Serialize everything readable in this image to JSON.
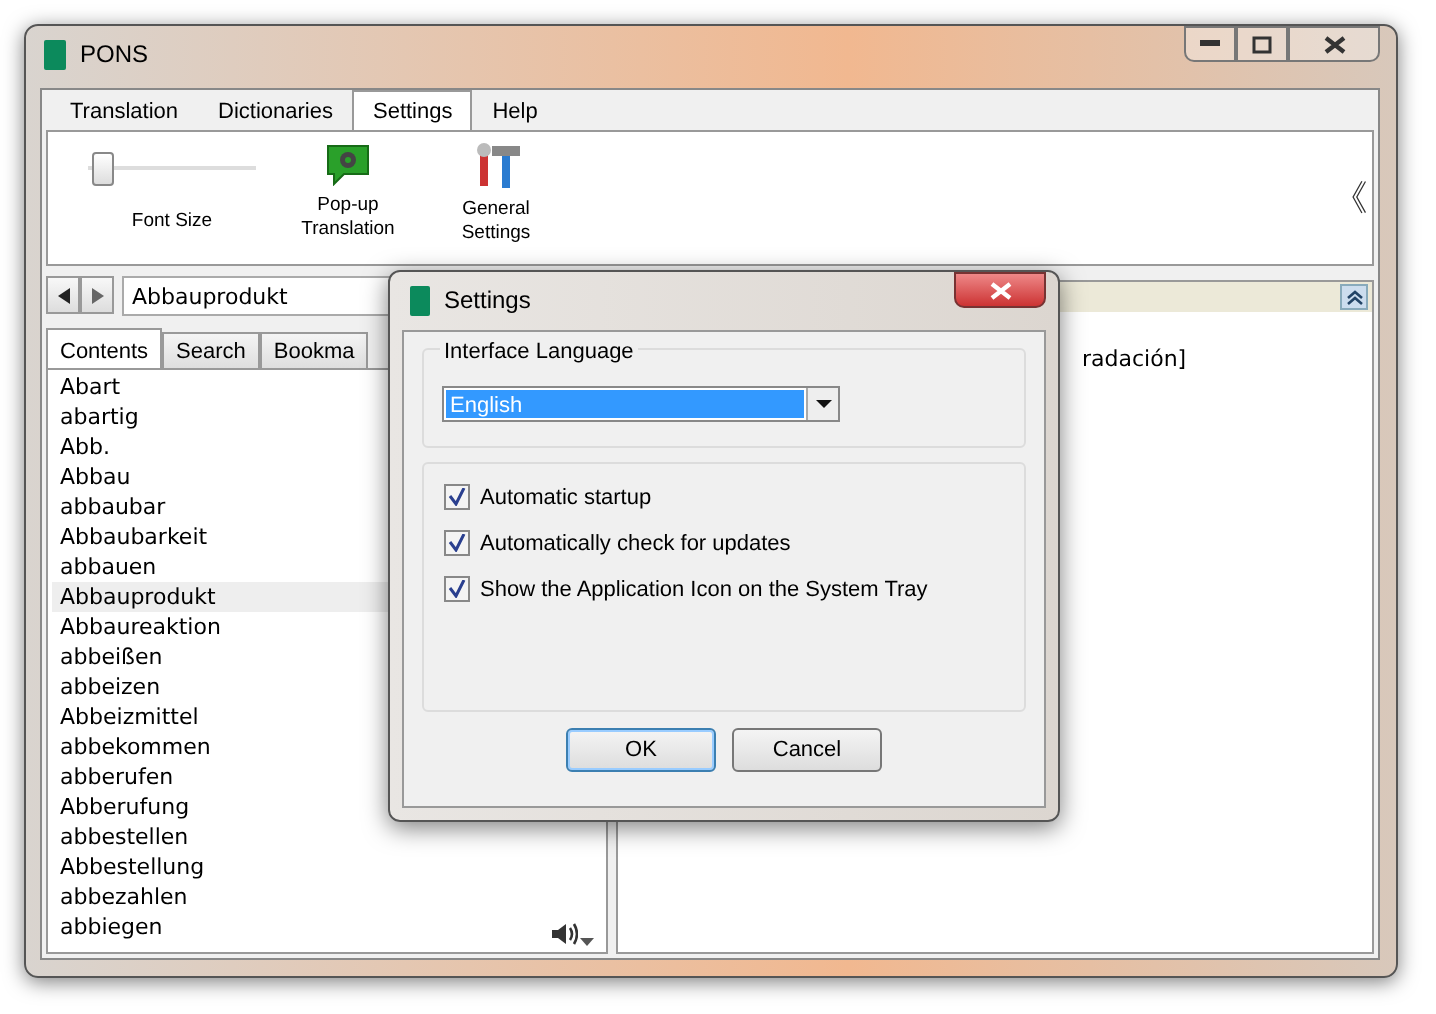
{
  "window": {
    "title": "PONS"
  },
  "tabs": [
    {
      "label": "Translation",
      "selected": false
    },
    {
      "label": "Dictionaries",
      "selected": false
    },
    {
      "label": "Settings",
      "selected": true
    },
    {
      "label": "Help",
      "selected": false
    }
  ],
  "ribbon": {
    "font_size": {
      "label": "Font Size",
      "level": 0.03
    },
    "buttons": [
      {
        "kind": "popup",
        "label": "Pop-up Translation"
      },
      {
        "kind": "general",
        "label": "General Settings"
      }
    ],
    "collapse": "《"
  },
  "search": {
    "value": "Abbauprodukt"
  },
  "pane_tabs": [
    {
      "label": "Contents",
      "selected": true
    },
    {
      "label": "Search",
      "selected": false
    },
    {
      "label": "Bookma",
      "selected": false
    }
  ],
  "words": [
    {
      "text": "Abart",
      "selected": false
    },
    {
      "text": "abartig",
      "selected": false
    },
    {
      "text": "Abb.",
      "selected": false
    },
    {
      "text": "Abbau",
      "selected": false
    },
    {
      "text": "abbaubar",
      "selected": false
    },
    {
      "text": "Abbaubarkeit",
      "selected": false
    },
    {
      "text": "abbauen",
      "selected": false
    },
    {
      "text": "Abbauprodukt",
      "selected": true
    },
    {
      "text": "Abbaureaktion",
      "selected": false
    },
    {
      "text": "abbeißen",
      "selected": false
    },
    {
      "text": "abbeizen",
      "selected": false
    },
    {
      "text": "Abbeizmittel",
      "selected": false
    },
    {
      "text": "abbekommen",
      "selected": false
    },
    {
      "text": "abberufen",
      "selected": false
    },
    {
      "text": "Abberufung",
      "selected": false
    },
    {
      "text": "abbestellen",
      "selected": false
    },
    {
      "text": "Abbestellung",
      "selected": false
    },
    {
      "text": "abbezahlen",
      "selected": false
    },
    {
      "text": "abbiegen",
      "selected": false
    }
  ],
  "entry": {
    "text": "radación]"
  },
  "dialog": {
    "title": "Settings",
    "group_label": "Interface Language",
    "language": "English",
    "options": [
      {
        "label": "Automatic startup",
        "checked": true
      },
      {
        "label": "Automatically check for updates",
        "checked": true
      },
      {
        "label": "Show the Application Icon on the System Tray",
        "checked": true
      }
    ],
    "buttons": [
      {
        "label": "OK",
        "selected": true
      },
      {
        "label": "Cancel",
        "selected": false
      }
    ]
  }
}
